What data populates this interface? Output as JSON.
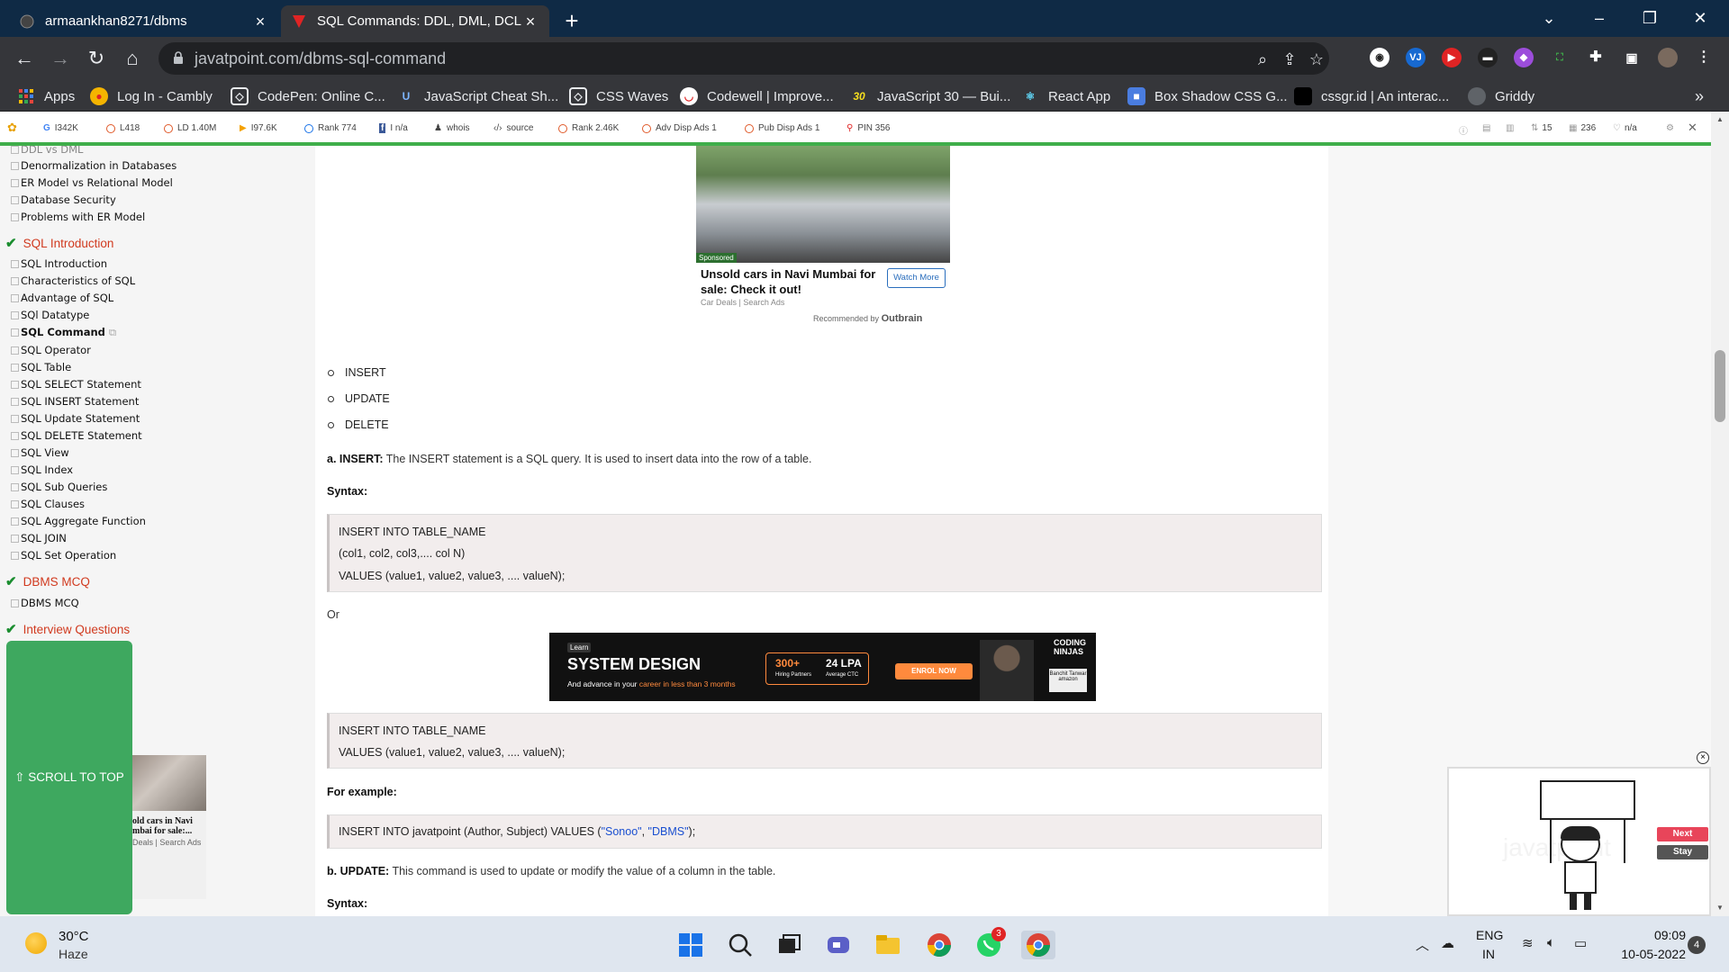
{
  "browser": {
    "tabs": [
      {
        "title": "armaankhan8271/dbms",
        "icon": "github-icon"
      },
      {
        "title": "SQL Commands: DDL, DML, DCL...",
        "icon": "javatpoint-icon"
      }
    ],
    "new_tab_label": "+",
    "url": "javatpoint.com/dbms-sql-command"
  },
  "bookmarks": [
    {
      "label": "Apps",
      "icon": "apps-grid-icon"
    },
    {
      "label": "Log In - Cambly",
      "icon": "cambly-icon"
    },
    {
      "label": "CodePen: Online C...",
      "icon": "codepen-icon"
    },
    {
      "label": "JavaScript Cheat Sh...",
      "icon": "shield-icon"
    },
    {
      "label": "CSS Waves",
      "icon": "codepen-icon"
    },
    {
      "label": "Codewell | Improve...",
      "icon": "codewell-icon"
    },
    {
      "label": "JavaScript 30 — Bui...",
      "icon": "js30-icon"
    },
    {
      "label": "React App",
      "icon": "react-icon"
    },
    {
      "label": "Box Shadow CSS G...",
      "icon": "box-icon"
    },
    {
      "label": "cssgr.id | An interac...",
      "icon": "cssgrid-icon"
    },
    {
      "label": "Griddy",
      "icon": "griddy-icon"
    }
  ],
  "seo_toolbar": {
    "items": [
      "I342K",
      "L418",
      "LD 1.40M",
      "I97.6K",
      "Rank 774",
      "I n/a",
      "whois",
      "source",
      "Rank 2.46K",
      "Adv Disp Ads  1",
      "Pub Disp Ads  1",
      "PIN 356"
    ],
    "right_items": [
      "15",
      "236",
      "n/a"
    ]
  },
  "sidebar": {
    "partial_top": "DDL vs DML",
    "group1": [
      "Denormalization in Databases",
      "ER Model vs Relational Model",
      "Database Security",
      "Problems with ER Model"
    ],
    "heading_sql": "SQL Introduction",
    "sql_items": [
      "SQL Introduction",
      "Characteristics of SQL",
      "Advantage of SQL",
      "SQl Datatype",
      "SQL Command",
      "SQL Operator",
      "SQL Table",
      "SQL SELECT Statement",
      "SQL INSERT Statement",
      "SQL Update Statement",
      "SQL DELETE Statement",
      "SQL View",
      "SQL Index",
      "SQL Sub Queries",
      "SQL Clauses",
      "SQL Aggregate Function",
      "SQL JOIN",
      "SQL Set Operation"
    ],
    "heading_mcq": "DBMS MCQ",
    "mcq_items": [
      "DBMS MCQ"
    ],
    "heading_interview": "Interview Questions",
    "scroll_top": "⇧ SCROLL TO TOP",
    "ad_title": "old cars in Navi\nmbai for sale:...",
    "ad_source": "Deals | Search Ads"
  },
  "top_ad": {
    "sponsored": "Sponsored",
    "title": "Unsold cars in Navi Mumbai for sale: Check it out!",
    "source": "Car Deals | Search Ads",
    "button": "Watch More",
    "recommended_by": "Recommended by",
    "brand": "Outbrain"
  },
  "content": {
    "bullets": [
      "INSERT",
      "UPDATE",
      "DELETE"
    ],
    "insert_label": "a. INSERT:",
    "insert_desc": " The INSERT statement is a SQL query. It is used to insert data into the row of a table.",
    "syntax1": "Syntax:",
    "code1": [
      "INSERT INTO TABLE_NAME",
      "(col1, col2, col3,.... col N)",
      "VALUES (value1, value2, value3, .... valueN);"
    ],
    "or": "Or",
    "code2": [
      "INSERT INTO TABLE_NAME",
      "VALUES (value1, value2, value3, .... valueN);"
    ],
    "for_example": "For example:",
    "code3_pre": "INSERT INTO javatpoint (Author, Subject) VALUES (",
    "code3_s1": "\"Sonoo\"",
    "code3_mid": ", ",
    "code3_s2": "\"DBMS\"",
    "code3_post": ");",
    "update_label": "b. UPDATE:",
    "update_desc": " This command is used to update or modify the value of a column in the table.",
    "syntax2": "Syntax:"
  },
  "mid_ad": {
    "learn": "Learn",
    "title": "SYSTEM DESIGN",
    "sub_pre": "And advance in your ",
    "sub_hl": "career in less than 3 months",
    "stat1": "300+",
    "stat1_sub": "Hiring Partners",
    "stat2": "24 LPA",
    "stat2_sub": "Average CTC",
    "cta": "ENROL NOW",
    "brand": "CODING NINJAS",
    "speaker": "Banchit Tanwar\namazon"
  },
  "video_widget": {
    "watermark": "javatpoint",
    "next": "Next",
    "stay": "Stay",
    "close": "×"
  },
  "taskbar": {
    "temp": "30°C",
    "weather": "Haze",
    "whatsapp_badge": "3",
    "lang1": "ENG",
    "lang2": "IN",
    "time": "09:09",
    "date": "10-05-2022",
    "notifications": "4"
  },
  "colors": {
    "accent_red": "#d13a1f",
    "check_green": "#1a8d2f",
    "scroll_green": "#3ea85f",
    "seo_green_line": "#3fae4a",
    "string_blue": "#1a4fd0"
  }
}
